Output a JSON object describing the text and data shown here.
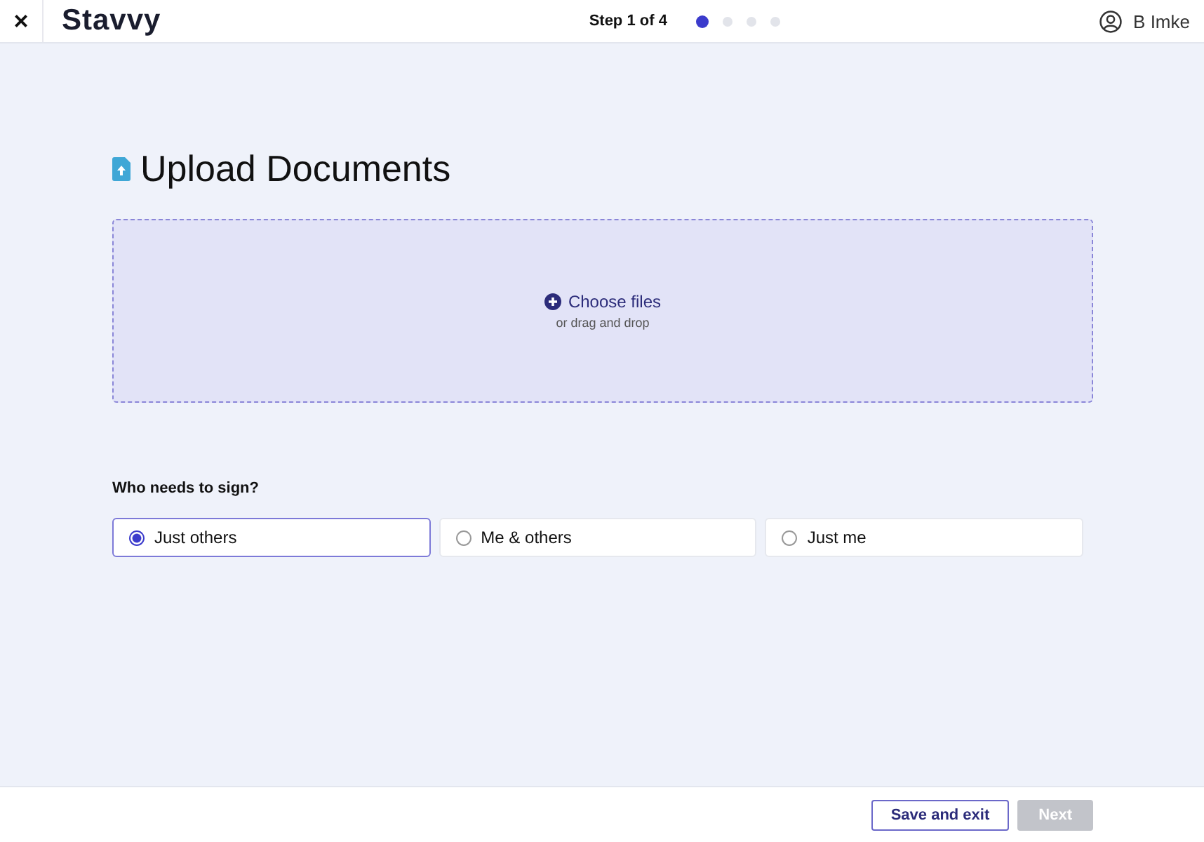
{
  "header": {
    "close": "×",
    "logo": "Stavvy",
    "step": "Step 1 of 4",
    "steps": [
      {
        "selected": true
      },
      {
        "selected": false
      },
      {
        "selected": false
      },
      {
        "selected": false
      }
    ],
    "user": "B Imke"
  },
  "title": "Upload Documents",
  "dropzone": {
    "action": "Choose files",
    "hint": "or drag and drop"
  },
  "signers": {
    "label": "Who needs to sign?",
    "options": [
      {
        "label": "Just others",
        "selected": true
      },
      {
        "label": "Me & others",
        "selected": false
      },
      {
        "label": "Just me",
        "selected": false
      }
    ]
  },
  "footer": {
    "buttons": [
      {
        "label": "Save and exit",
        "disabled": false
      },
      {
        "label": "Next",
        "disabled": true
      }
    ]
  }
}
